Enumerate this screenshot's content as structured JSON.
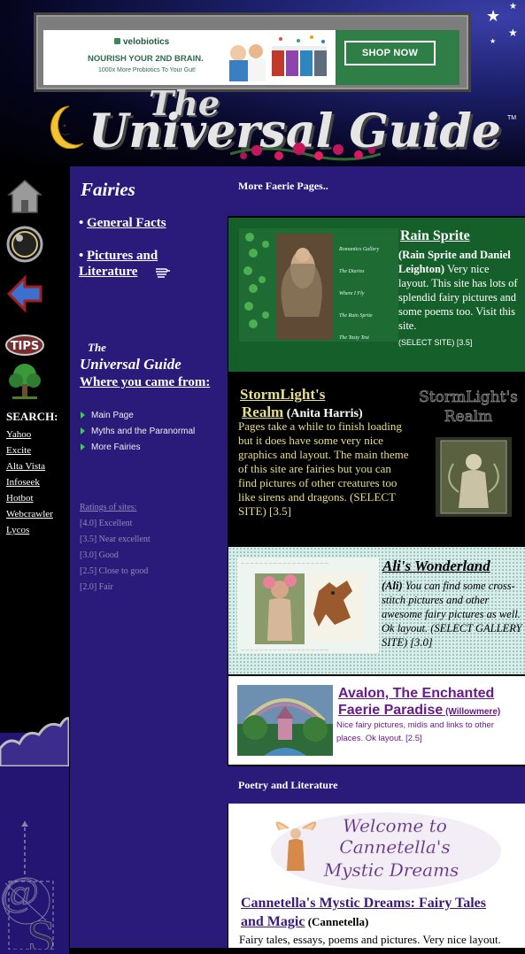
{
  "ad": {
    "brand": "velobiotics",
    "headline": "NOURISH YOUR 2ND BRAIN.",
    "subline": "1000x More Probiotics To Your Gut!",
    "cta": "SHOP NOW"
  },
  "header": {
    "title_the": "The",
    "title_main": "Universal Guide",
    "trademark": "TM"
  },
  "left_nav": {
    "icons": [
      "home-icon",
      "crystal-ball-icon",
      "back-arrow-icon",
      "tips-icon",
      "tree-icon"
    ],
    "search_label": "SEARCH:",
    "search_engines": [
      "Yahoo",
      "Excite",
      "Alta Vista",
      "Infoseek",
      "Hotbot",
      "Webcrawler",
      "Lycos"
    ]
  },
  "nav": {
    "section_title": "Fairies",
    "links": [
      "General Facts",
      "Pictures and Literature"
    ],
    "guide_the": "The",
    "guide_name": "Universal Guide",
    "came_from": "Where you came from:",
    "breadcrumbs": [
      "Main Page",
      "Myths and the Paranormal",
      "More Fairies"
    ],
    "ratings_title": "Ratings of sites:",
    "ratings": [
      "[4.0] Excellent",
      "[3.5] Near excellent",
      "[3.0] Good",
      "[2.5] Close to good",
      "[2.0] Fair"
    ]
  },
  "main": {
    "section1": "More Faerie Pages..",
    "section2": "Poetry and Literature",
    "rain": {
      "title": "Rain Sprite",
      "author": "(Rain Sprite and Daniel Leighton)",
      "body": " Very nice layout. This site has lots of splendid fairy pictures and some poems too. Visit this site.",
      "select": "(SELECT SITE) [3.5]",
      "menu": [
        "Romantics Gallery",
        "The Diaries",
        "Where I Fly",
        "The Rain Sprite",
        "The Tasty Test"
      ]
    },
    "storm": {
      "title_a": "StormLight's",
      "title_b": "Realm",
      "author": " (Anita Harris)",
      "body": "Pages take a while to finish loading but it does have some very nice graphics and layout. The main theme of this site are fairies but you can find pictures of other creatures too like sirens and dragons. (SELECT SITE) [3.5]",
      "logo_a": "StormLight's",
      "logo_b": "Realm"
    },
    "ali": {
      "title": "Ali's Wonderland",
      "author": "(Ali)",
      "body": " You can find some cross-stitch pictures and other awesome fairy pictures as well. Ok layout. (SELECT GALLERY SITE) [3.0]"
    },
    "avalon": {
      "title": "Avalon, The Enchanted Faerie Paradise",
      "author": " (Willowmere)",
      "body": "Nice fairy pictures, midis and links to other places. Ok layout. [2.5]"
    },
    "cann": {
      "banner_line1": "Welcome to",
      "banner_line2": "Cannetella's",
      "banner_line3": "Mystic Dreams",
      "title": "Cannetella's Mystic Dreams: Fairy Tales and Magic",
      "author": " (Cannetella)",
      "body": "Fairy tales, essays, poems and pictures. Very nice layout."
    }
  }
}
